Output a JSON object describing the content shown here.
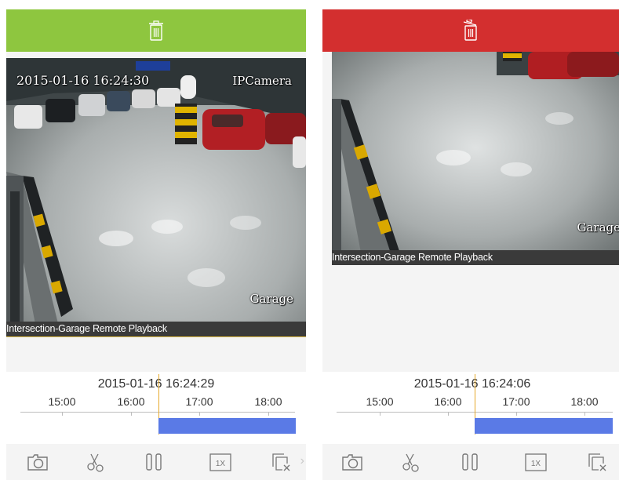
{
  "left_panel": {
    "header_color": "#8ec63f",
    "osd_datetime": "2015-01-16 16:24:30",
    "osd_channel": "IPCamera",
    "osd_location": "Garage",
    "caption": "Intersection-Garage Remote Playback",
    "timeline": {
      "timestamp": "2015-01-16 16:24:29",
      "ticks": [
        "15:00",
        "16:00",
        "17:00",
        "18:00"
      ]
    }
  },
  "right_panel": {
    "header_color": "#d32f2f",
    "osd_location": "Garage",
    "caption": "Intersection-Garage Remote Playback",
    "timeline": {
      "timestamp": "2015-01-16 16:24:06",
      "ticks": [
        "15:00",
        "16:00",
        "17:00",
        "18:00"
      ]
    }
  },
  "controls": {
    "speed_label": "1X",
    "icons": [
      "camera-icon",
      "scissors-icon",
      "pause-icon",
      "speed-icon",
      "stop-all-icon"
    ]
  },
  "colors": {
    "record_bar": "#5a7ae6",
    "cursor": "#e6a92a",
    "icon": "#777777"
  }
}
